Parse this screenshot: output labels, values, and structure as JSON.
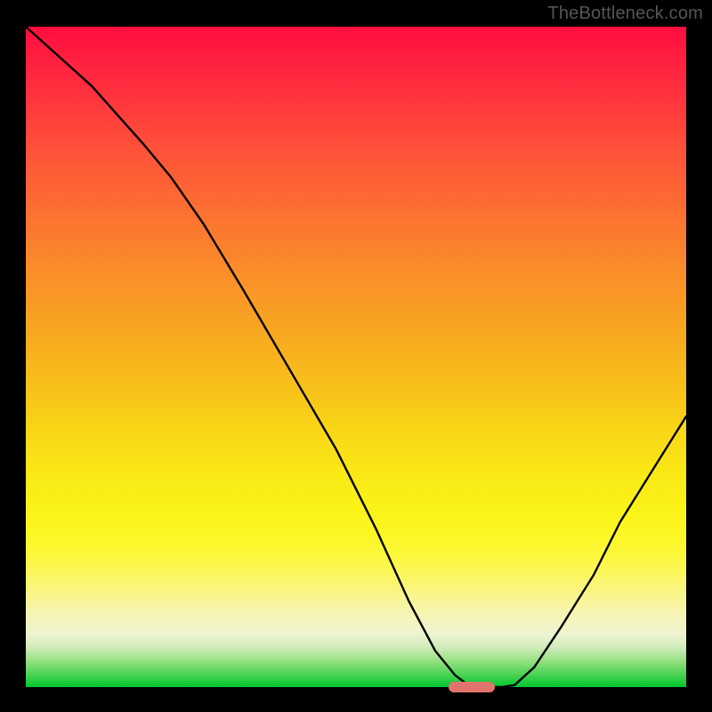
{
  "watermark": "TheBottleneck.com",
  "chart_data": {
    "type": "line",
    "title": "",
    "xlabel": "",
    "ylabel": "",
    "x": [
      0.0,
      0.05,
      0.1,
      0.14,
      0.18,
      0.22,
      0.27,
      0.33,
      0.4,
      0.47,
      0.53,
      0.58,
      0.62,
      0.65,
      0.67,
      0.69,
      0.72,
      0.74,
      0.77,
      0.81,
      0.86,
      0.9,
      0.95,
      1.0
    ],
    "values": [
      1.0,
      0.955,
      0.91,
      0.865,
      0.82,
      0.772,
      0.7,
      0.6,
      0.48,
      0.36,
      0.24,
      0.13,
      0.055,
      0.018,
      0.003,
      0.0,
      0.0,
      0.003,
      0.03,
      0.09,
      0.17,
      0.25,
      0.33,
      0.41
    ],
    "xlim": [
      0,
      1
    ],
    "ylim": [
      0,
      1
    ],
    "grid": false,
    "background": "red-yellow-green vertical gradient",
    "marker": {
      "x_start": 0.64,
      "x_end": 0.71,
      "y": 0.0,
      "color": "#e0746d"
    }
  },
  "colors": {
    "background": "#000000",
    "curve": "#000000",
    "marker": "#e0746d",
    "watermark": "#555555"
  }
}
